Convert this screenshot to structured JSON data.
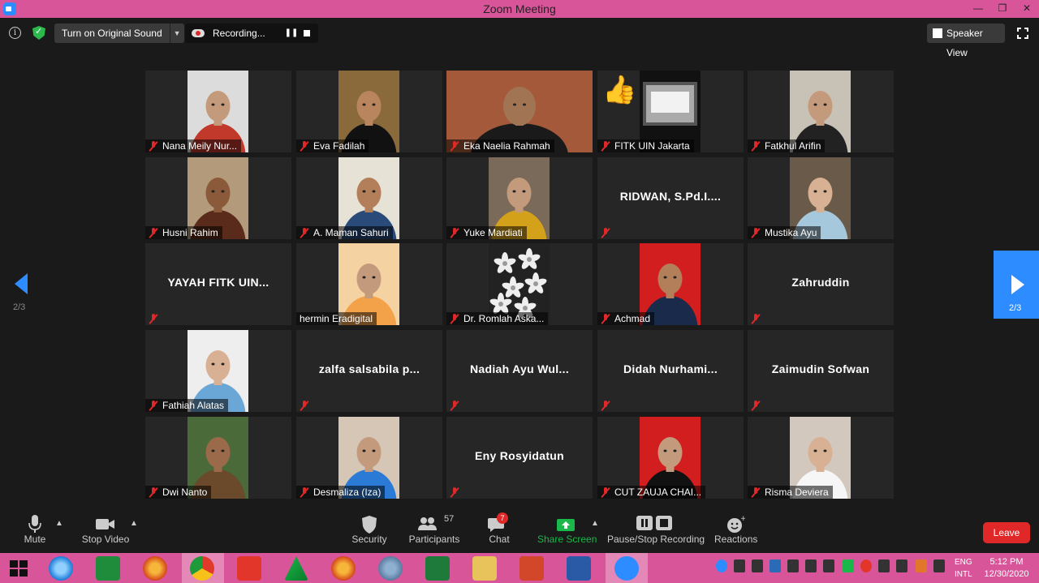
{
  "window": {
    "title": "Zoom Meeting"
  },
  "topbar": {
    "original_sound": "Turn on Original Sound",
    "recording": "Recording...",
    "view_mode": "Speaker View"
  },
  "pagination": {
    "current": "2/3"
  },
  "participants": [
    {
      "name": "Nana Meily Nur...",
      "video": true,
      "skin": "#c49a7c",
      "bg": "#dcdcdc",
      "cloth": "#c0392b"
    },
    {
      "name": "Eva Fadilah",
      "video": true,
      "skin": "#b8855f",
      "bg": "#8a6a3a",
      "cloth": "#111111"
    },
    {
      "name": "Eka Naelia Rahmah",
      "video": true,
      "skin": "#a17454",
      "bg": "#a45a3a",
      "cloth": "#1a1a1a",
      "wide": true
    },
    {
      "name": "FITK UIN Jakarta",
      "video": true,
      "thumbs": true,
      "bg": "#111111",
      "cloth": "#aaaaaa"
    },
    {
      "name": "Fatkhul Arifin",
      "video": true,
      "skin": "#c49a7c",
      "bg": "#c8c2b6",
      "cloth": "#222222"
    },
    {
      "name": "Husni Rahim",
      "video": true,
      "skin": "#8a5a3a",
      "bg": "#b29a7a",
      "cloth": "#5a2a1a"
    },
    {
      "name": "A. Maman Sahuri",
      "video": true,
      "skin": "#b27f5a",
      "bg": "#e6e2d6",
      "cloth": "#2a4a7a"
    },
    {
      "name": "Yuke Mardiati",
      "video": true,
      "skin": "#c49a7c",
      "bg": "#7a6a5a",
      "cloth": "#d4a21a"
    },
    {
      "name": "RIDWAN,  S.Pd.I....",
      "video": false
    },
    {
      "name": "Mustika Ayu",
      "video": true,
      "skin": "#d8b094",
      "bg": "#6a5a4a",
      "cloth": "#a6c8dc"
    },
    {
      "name": "YAYAH FITK UIN...",
      "video": false
    },
    {
      "name": "hermin Eradigital",
      "video": true,
      "skin": "#c49a7c",
      "bg": "#f4d2a2",
      "cloth": "#f4a24a",
      "no_mute": true
    },
    {
      "name": "Dr. Romlah Aska...",
      "video": true,
      "flowers": true,
      "bg": "#222222",
      "cloth": "#eeeeee"
    },
    {
      "name": "Achmad",
      "video": true,
      "skin": "#b27f5a",
      "bg": "#d21e1e",
      "cloth": "#1a2a4a"
    },
    {
      "name": "Zahruddin",
      "video": false
    },
    {
      "name": "Fathiah Alatas",
      "video": true,
      "skin": "#d8b094",
      "bg": "#eeeeee",
      "cloth": "#6aa6d6"
    },
    {
      "name": "zalfa salsabila p...",
      "video": false
    },
    {
      "name": "Nadiah Ayu Wul...",
      "video": false
    },
    {
      "name": "Didah  Nurhami...",
      "video": false
    },
    {
      "name": "Zaimudin Sofwan",
      "video": false
    },
    {
      "name": "Dwi Nanto",
      "video": true,
      "skin": "#9a6a4a",
      "bg": "#4a6a3a",
      "cloth": "#6a4a2a"
    },
    {
      "name": "Desmaliza (Iza)",
      "video": true,
      "skin": "#c49a7c",
      "bg": "#d6c6b6",
      "cloth": "#2a7ad6"
    },
    {
      "name": "Eny Rosyidatun",
      "video": false
    },
    {
      "name": "CUT ZAUJA CHAI...",
      "video": true,
      "skin": "#c49a7c",
      "bg": "#d21e1e",
      "cloth": "#111111"
    },
    {
      "name": "Risma Deviera",
      "video": true,
      "skin": "#d8b094",
      "bg": "#d2c8be",
      "cloth": "#f6f6f6"
    }
  ],
  "toolbar": {
    "mute": "Mute",
    "stop_video": "Stop Video",
    "security": "Security",
    "participants": "Participants",
    "participants_count": "57",
    "chat": "Chat",
    "chat_badge": "7",
    "share_screen": "Share Screen",
    "pause_stop_recording": "Pause/Stop Recording",
    "reactions": "Reactions",
    "leave": "Leave"
  },
  "taskbar": {
    "lang_1": "ENG",
    "lang_2": "INTL",
    "time": "5:12 PM",
    "date": "12/30/2020"
  },
  "colors": {
    "accent": "#2d8cff",
    "titlebar": "#d9559a",
    "leave": "#e02828",
    "share": "#1ab74a"
  }
}
